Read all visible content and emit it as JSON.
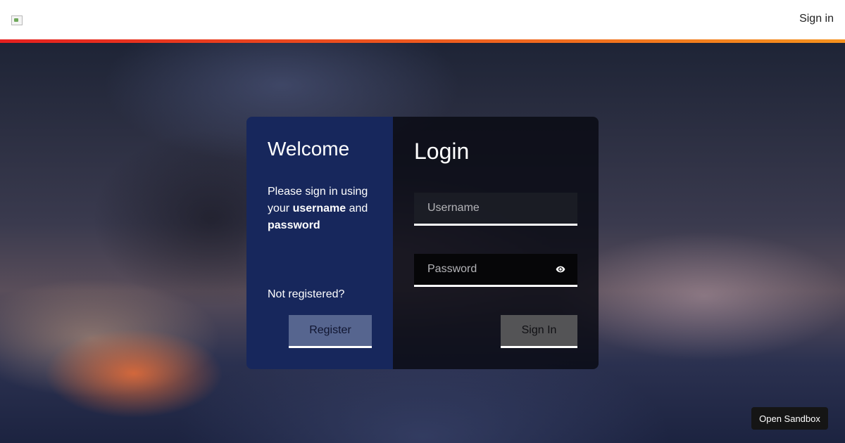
{
  "header": {
    "signin_label": "Sign in"
  },
  "colors": {
    "accent_start": "#e5201f",
    "accent_end": "#f5921e",
    "welcome_panel": "#17275c",
    "register_button": "#56658f",
    "signin_button": "#545456"
  },
  "welcome": {
    "title": "Welcome",
    "text_before": "Please sign in using your ",
    "username_word": "username",
    "text_and": " and ",
    "password_word": "password",
    "not_registered": "Not registered?",
    "register_label": "Register"
  },
  "login": {
    "title": "Login",
    "username_placeholder": "Username",
    "password_placeholder": "Password",
    "password_toggle_icon": "eye-icon",
    "submit_label": "Sign In"
  },
  "sandbox": {
    "label": "Open Sandbox"
  }
}
